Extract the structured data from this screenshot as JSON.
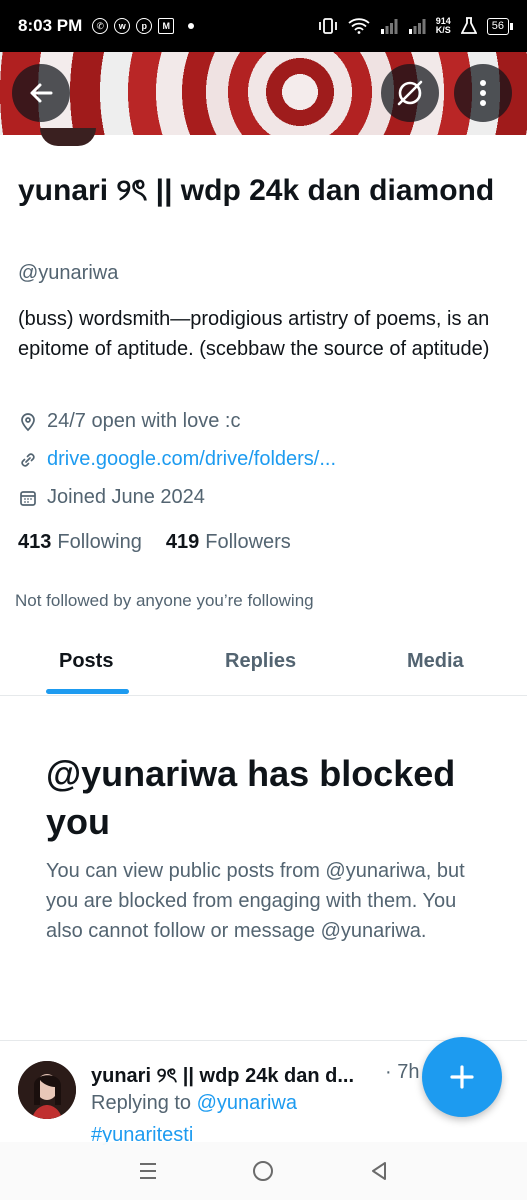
{
  "status_bar": {
    "time": "8:03 PM",
    "net_speed_value": "914",
    "net_speed_unit": "K/S",
    "battery": "56"
  },
  "profile": {
    "name": "yunari ୨ৎ || wdp 24k dan diamond",
    "handle": "@yunariwa",
    "bio": "(buss) wordsmith—prodigious artistry of poems, is an epitome of aptitude. (scebbaw the source of aptitude)",
    "location": "24/7 open with love :c",
    "link": "drive.google.com/drive/folders/...",
    "joined": "Joined June 2024",
    "following_count": "413",
    "following_label": "Following",
    "followers_count": "419",
    "followers_label": "Followers",
    "not_followed_text": "Not followed by anyone you’re following"
  },
  "tabs": [
    {
      "label": "Posts",
      "active": true
    },
    {
      "label": "Replies",
      "active": false
    },
    {
      "label": "Media",
      "active": false
    }
  ],
  "blocked": {
    "title": "@yunariwa has blocked you",
    "body": "You can view public posts from @yunariwa, but you are blocked from engaging with them. You also cannot follow or message @yunariwa."
  },
  "post": {
    "author": "yunari ୨ৎ || wdp 24k dan d...",
    "time": "· 7h",
    "replying_prefix": "Replying to",
    "replying_to": "@yunariwa",
    "hashtag": "#yunaritesti"
  },
  "colors": {
    "accent": "#1d9bf0",
    "secondary_text": "#536471",
    "primary_text": "#0f1419"
  }
}
